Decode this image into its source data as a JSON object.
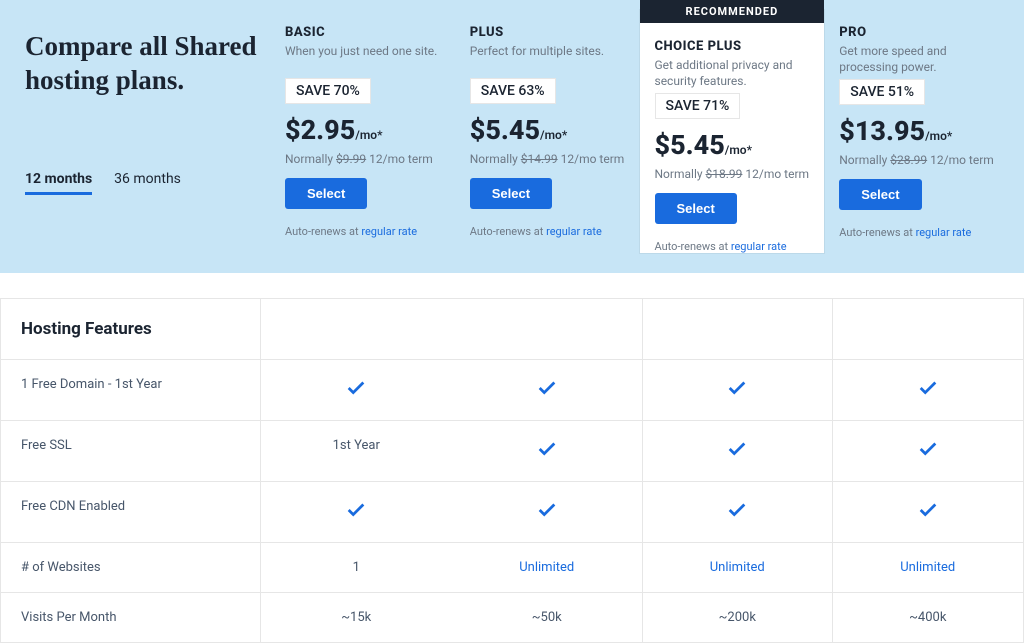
{
  "headline": "Compare all Shared hosting plans.",
  "term_tabs": {
    "t12": "12 months",
    "t36": "36 months"
  },
  "badge": "RECOMMENDED",
  "common": {
    "select": "Select",
    "normally_prefix": "Normally ",
    "normally_suffix": " 12/mo term",
    "renews_prefix": "Auto-renews at ",
    "renews_link": "regular rate",
    "per": "/mo*"
  },
  "plans": [
    {
      "name": "BASIC",
      "desc": "When you just need one site.",
      "save": "SAVE 70%",
      "price": "$2.95",
      "normal": "$9.99"
    },
    {
      "name": "PLUS",
      "desc": "Perfect for multiple sites.",
      "save": "SAVE 63%",
      "price": "$5.45",
      "normal": "$14.99"
    },
    {
      "name": "CHOICE PLUS",
      "desc": "Get additional privacy and security features.",
      "save": "SAVE 71%",
      "price": "$5.45",
      "normal": "$18.99"
    },
    {
      "name": "PRO",
      "desc": "Get more speed and processing power.",
      "save": "SAVE 51%",
      "price": "$13.95",
      "normal": "$28.99"
    }
  ],
  "features_header": "Hosting Features",
  "features": [
    {
      "label": "1 Free Domain - 1st Year",
      "cells": [
        "check",
        "check",
        "check",
        "check"
      ]
    },
    {
      "label": "Free SSL",
      "cells": [
        "1st Year",
        "check",
        "check",
        "check"
      ]
    },
    {
      "label": "Free CDN Enabled",
      "cells": [
        "check",
        "check",
        "check",
        "check"
      ]
    },
    {
      "label": "# of Websites",
      "cells": [
        "1",
        "Unlimited",
        "Unlimited",
        "Unlimited"
      ],
      "blue": [
        false,
        true,
        true,
        true
      ]
    },
    {
      "label": "Visits Per Month",
      "cells": [
        "~15k",
        "~50k",
        "~200k",
        "~400k"
      ]
    }
  ]
}
